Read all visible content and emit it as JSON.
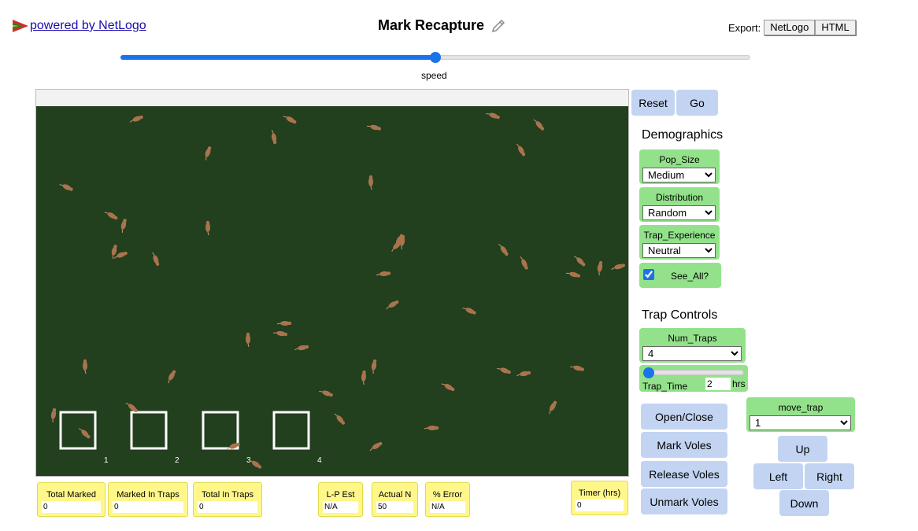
{
  "header": {
    "powered_by": "powered by NetLogo",
    "title": "Mark Recapture",
    "export_label": "Export:",
    "export_netlogo": "NetLogo",
    "export_html": "HTML"
  },
  "speed": {
    "label": "speed",
    "value": 0.5
  },
  "buttons": {
    "reset": "Reset",
    "go": "Go"
  },
  "demographics": {
    "heading": "Demographics",
    "pop_size": {
      "label": "Pop_Size",
      "value": "Medium"
    },
    "distribution": {
      "label": "Distribution",
      "value": "Random"
    },
    "trap_experience": {
      "label": "Trap_Experience",
      "value": "Neutral"
    },
    "see_all": {
      "label": "See_All?",
      "checked": true
    }
  },
  "trap_controls": {
    "heading": "Trap Controls",
    "num_traps": {
      "label": "Num_Traps",
      "value": "4"
    },
    "trap_time": {
      "label": "Trap_Time",
      "value": "2",
      "unit": "hrs",
      "slider_fraction": 0.0
    },
    "open_close": "Open/Close",
    "mark_voles": "Mark Voles",
    "release_voles": "Release Voles",
    "unmark_voles": "Unmark Voles",
    "move_trap": {
      "label": "move_trap",
      "value": "1"
    },
    "up": "Up",
    "left": "Left",
    "right": "Right",
    "down": "Down"
  },
  "world": {
    "background": "#223f1e",
    "vole_color": "#a9744d",
    "trap_labels": [
      "1",
      "2",
      "3",
      "4"
    ]
  },
  "monitors": {
    "total_marked": {
      "label": "Total Marked",
      "value": "0"
    },
    "marked_in_traps": {
      "label": "Marked In Traps",
      "value": "0"
    },
    "total_in_traps": {
      "label": "Total In Traps",
      "value": "0"
    },
    "lp_est": {
      "label": "L-P Est",
      "value": "N/A"
    },
    "actual_n": {
      "label": "Actual N",
      "value": "50"
    },
    "pct_error": {
      "label": "% Error",
      "value": "N/A"
    },
    "timer": {
      "label": "Timer (hrs)",
      "value": "0"
    }
  },
  "colors": {
    "button_blue": "#c2d4f2",
    "widget_green": "#93e28b",
    "monitor_yellow": "#fff78a",
    "accent": "#1a73e8"
  }
}
